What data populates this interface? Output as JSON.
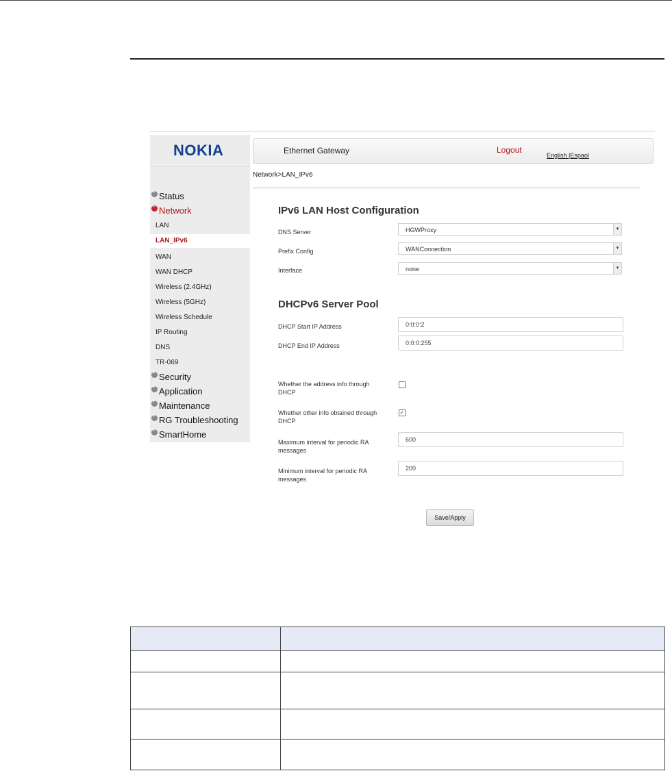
{
  "brand": {
    "logo": "NOKIA"
  },
  "header": {
    "title": "Ethernet Gateway",
    "logout": "Logout",
    "languages": "English |Espaol"
  },
  "breadcrumb": "Network>LAN_IPv6",
  "sidebar": {
    "status": "Status",
    "network": "Network",
    "network_items": [
      "LAN",
      "LAN_IPv6",
      "WAN",
      "WAN DHCP",
      "Wireless (2.4GHz)",
      "Wireless (5GHz)",
      "Wireless Schedule",
      "IP Routing",
      "DNS",
      "TR-069"
    ],
    "security": "Security",
    "application": "Application",
    "maintenance": "Maintenance",
    "rg_troubleshooting": "RG Troubleshooting",
    "smarthome": "SmartHome"
  },
  "host_config": {
    "title": "IPv6 LAN Host Configuration",
    "dns_server": {
      "label": "DNS Server",
      "value": "HGWProxy"
    },
    "prefix_config": {
      "label": "Prefix Config",
      "value": "WANConnection"
    },
    "interface": {
      "label": "Interface",
      "value": "none"
    }
  },
  "server_pool": {
    "title": "DHCPv6 Server Pool",
    "start_ip": {
      "label": "DHCP Start IP Address",
      "value": "0:0:0:2"
    },
    "end_ip": {
      "label": "DHCP End IP Address",
      "value": "0:0:0:255"
    },
    "address_info": {
      "label": "Whether the address info through DHCP",
      "checked": false
    },
    "other_info": {
      "label": "Whether other info obtained through DHCP",
      "checked": true
    },
    "max_interval": {
      "label": "Maximum interval for periodic RA messages",
      "value": "600"
    },
    "min_interval": {
      "label": "Minimum interval for periodic RA messages",
      "value": "200"
    }
  },
  "save_button": "Save/Apply",
  "colors": {
    "brand_blue": "#124191",
    "accent_red": "#b01818",
    "table_header": "#e6eaf7"
  }
}
